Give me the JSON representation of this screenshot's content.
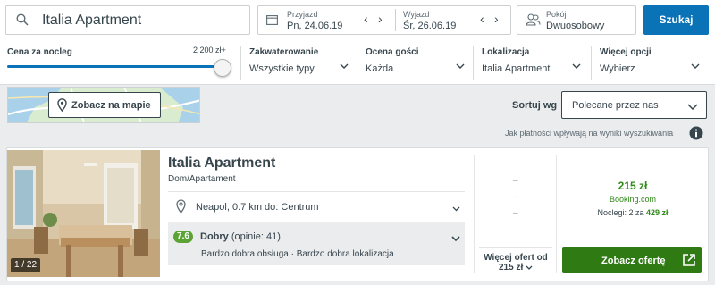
{
  "search": {
    "destination": "Italia Apartment",
    "button_label": "Szukaj"
  },
  "dates": {
    "checkin_label": "Przyjazd",
    "checkin_value": "Pn, 24.06.19",
    "checkout_label": "Wyjazd",
    "checkout_value": "Śr, 26.06.19",
    "prev_glyph": "‹",
    "next_glyph": "›"
  },
  "room": {
    "label": "Pokój",
    "value": "Dwuosobowy"
  },
  "filters": {
    "price_label": "Cena za nocleg",
    "price_max": "2 200 zł+",
    "price_fill_fraction": 1.0,
    "accommodation": {
      "label": "Zakwaterowanie",
      "value": "Wszystkie typy"
    },
    "rating": {
      "label": "Ocena gości",
      "value": "Każda"
    },
    "location": {
      "label": "Lokalizacja",
      "value": "Italia Apartment"
    },
    "more": {
      "label": "Więcej opcji",
      "value": "Wybierz"
    }
  },
  "map": {
    "button_label": "Zobacz na mapie"
  },
  "sort": {
    "label": "Sortuj wg",
    "value": "Polecane przez nas"
  },
  "payment_info": "Jak płatności wpływają na wyniki wyszukiwania",
  "result": {
    "title": "Italia Apartment",
    "type": "Dom/Apartament",
    "photo_counter": "1 / 22",
    "location": "Neapol, 0.7 km do: Centrum",
    "score": "7.6",
    "rating_word": "Dobry",
    "rating_count": "(opinie: 41)",
    "rating_desc": "Bardzo dobra obsługa · Bardzo dobra lokalizacja",
    "placeholder_dashes": [
      "–",
      "–",
      "–"
    ],
    "more_offers_line1": "Więcej ofert od",
    "more_offers_line2": "215 zł",
    "price": "215 zł",
    "provider": "Booking.com",
    "nights_prefix": "Noclegi: 2 za",
    "nights_total": "429 zł",
    "offer_button": "Zobacz ofertę"
  },
  "colors": {
    "accent_blue": "#0a73b7",
    "deal_green": "#2f7a13",
    "score_green": "#5ba335"
  },
  "icons": [
    "search-icon",
    "calendar-icon",
    "people-icon",
    "chevron-down-icon",
    "map-pin-icon",
    "info-icon",
    "external-link-icon"
  ]
}
